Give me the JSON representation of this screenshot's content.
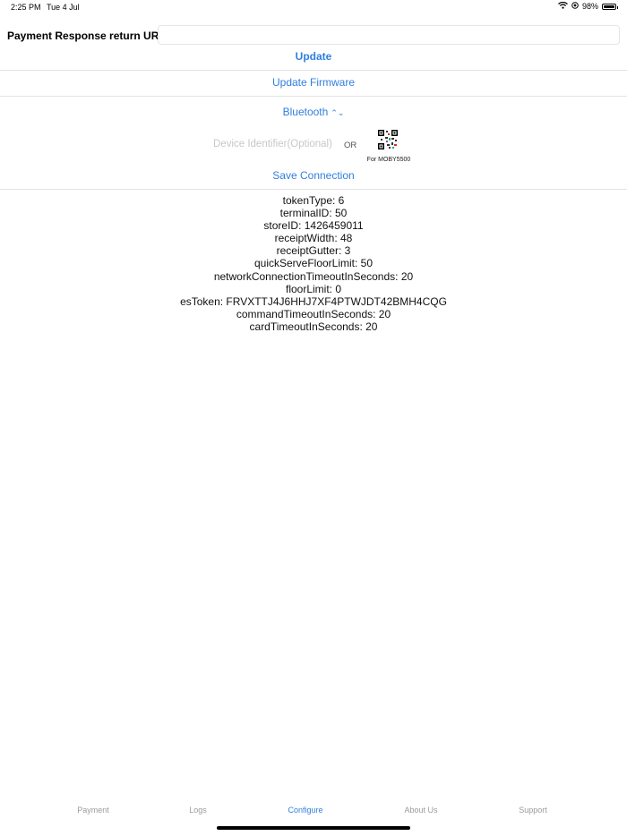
{
  "status_bar": {
    "time": "2:25 PM",
    "date": "Tue 4 Jul",
    "battery": "98%",
    "battery_level": 0.98
  },
  "payment_url": {
    "label": "Payment Response return URL :",
    "value": "",
    "placeholder": ""
  },
  "actions": {
    "update": "Update",
    "update_firmware": "Update Firmware",
    "save_connection": "Save Connection"
  },
  "connection": {
    "type": "Bluetooth",
    "device_identifier_placeholder": "Device Identifier(Optional)",
    "or": "OR",
    "qr_caption": "For MOBY5500"
  },
  "config": [
    "tokenType: 6",
    "terminalID: 50",
    "storeID: 1426459011",
    "receiptWidth: 48",
    "receiptGutter: 3",
    "quickServeFloorLimit: 50",
    "networkConnectionTimeoutInSeconds: 20",
    "floorLimit: 0",
    "esToken: FRVXTTJ4J6HHJ7XF4PTWJDT42BMH4CQG",
    "commandTimeoutInSeconds: 20",
    "cardTimeoutInSeconds: 20"
  ],
  "tabs": [
    {
      "label": "Payment",
      "active": false
    },
    {
      "label": "Logs",
      "active": false
    },
    {
      "label": "Configure",
      "active": true
    },
    {
      "label": "About Us",
      "active": false
    },
    {
      "label": "Support",
      "active": false
    }
  ],
  "colors": {
    "accent": "#2f7fe0",
    "inactive_tab": "#9a9a9a",
    "divider": "#e3e3e3"
  }
}
